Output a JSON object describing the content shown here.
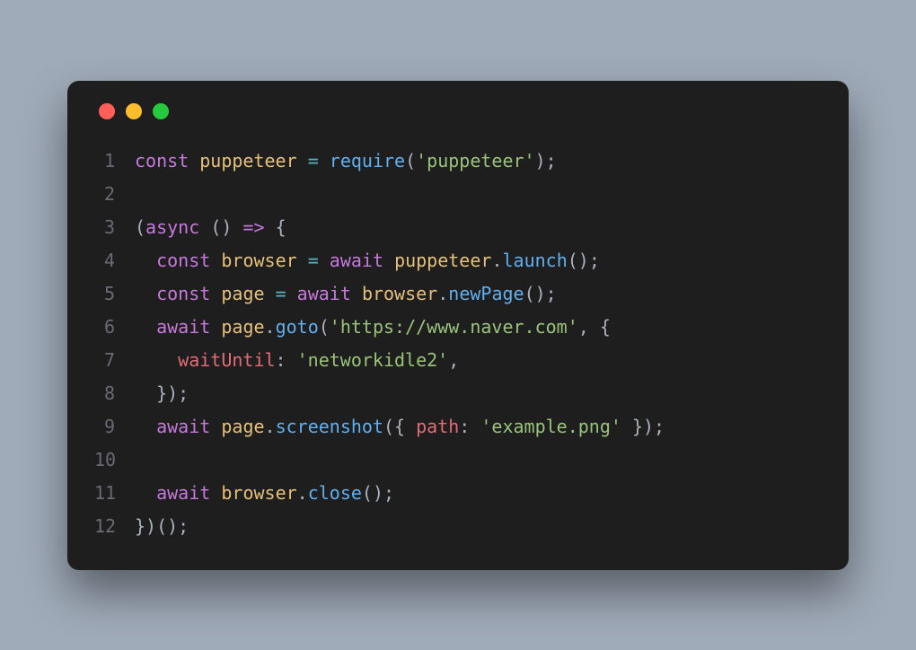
{
  "colors": {
    "red": "#ff5f56",
    "yellow": "#ffbd2e",
    "green": "#27c93f",
    "background": "#1e1e1e"
  },
  "code": {
    "lines": [
      {
        "n": "1",
        "tokens": [
          {
            "c": "kw",
            "t": "const"
          },
          {
            "c": "plain",
            "t": " "
          },
          {
            "c": "var",
            "t": "puppeteer"
          },
          {
            "c": "plain",
            "t": " "
          },
          {
            "c": "op",
            "t": "="
          },
          {
            "c": "plain",
            "t": " "
          },
          {
            "c": "fn",
            "t": "require"
          },
          {
            "c": "punc",
            "t": "("
          },
          {
            "c": "str",
            "t": "'puppeteer'"
          },
          {
            "c": "punc",
            "t": ");"
          }
        ]
      },
      {
        "n": "2",
        "tokens": []
      },
      {
        "n": "3",
        "tokens": [
          {
            "c": "punc",
            "t": "("
          },
          {
            "c": "kw",
            "t": "async"
          },
          {
            "c": "plain",
            "t": " "
          },
          {
            "c": "punc",
            "t": "()"
          },
          {
            "c": "plain",
            "t": " "
          },
          {
            "c": "kw",
            "t": "=>"
          },
          {
            "c": "plain",
            "t": " "
          },
          {
            "c": "punc",
            "t": "{"
          }
        ]
      },
      {
        "n": "4",
        "tokens": [
          {
            "c": "plain",
            "t": "  "
          },
          {
            "c": "kw",
            "t": "const"
          },
          {
            "c": "plain",
            "t": " "
          },
          {
            "c": "var",
            "t": "browser"
          },
          {
            "c": "plain",
            "t": " "
          },
          {
            "c": "op",
            "t": "="
          },
          {
            "c": "plain",
            "t": " "
          },
          {
            "c": "kw",
            "t": "await"
          },
          {
            "c": "plain",
            "t": " "
          },
          {
            "c": "var",
            "t": "puppeteer"
          },
          {
            "c": "punc",
            "t": "."
          },
          {
            "c": "fn",
            "t": "launch"
          },
          {
            "c": "punc",
            "t": "();"
          }
        ]
      },
      {
        "n": "5",
        "tokens": [
          {
            "c": "plain",
            "t": "  "
          },
          {
            "c": "kw",
            "t": "const"
          },
          {
            "c": "plain",
            "t": " "
          },
          {
            "c": "var",
            "t": "page"
          },
          {
            "c": "plain",
            "t": " "
          },
          {
            "c": "op",
            "t": "="
          },
          {
            "c": "plain",
            "t": " "
          },
          {
            "c": "kw",
            "t": "await"
          },
          {
            "c": "plain",
            "t": " "
          },
          {
            "c": "var",
            "t": "browser"
          },
          {
            "c": "punc",
            "t": "."
          },
          {
            "c": "fn",
            "t": "newPage"
          },
          {
            "c": "punc",
            "t": "();"
          }
        ]
      },
      {
        "n": "6",
        "tokens": [
          {
            "c": "plain",
            "t": "  "
          },
          {
            "c": "kw",
            "t": "await"
          },
          {
            "c": "plain",
            "t": " "
          },
          {
            "c": "var",
            "t": "page"
          },
          {
            "c": "punc",
            "t": "."
          },
          {
            "c": "fn",
            "t": "goto"
          },
          {
            "c": "punc",
            "t": "("
          },
          {
            "c": "str",
            "t": "'https://www.naver.com'"
          },
          {
            "c": "punc",
            "t": ", {"
          }
        ]
      },
      {
        "n": "7",
        "tokens": [
          {
            "c": "plain",
            "t": "    "
          },
          {
            "c": "prop",
            "t": "waitUntil"
          },
          {
            "c": "punc",
            "t": ": "
          },
          {
            "c": "str",
            "t": "'networkidle2'"
          },
          {
            "c": "punc",
            "t": ","
          }
        ]
      },
      {
        "n": "8",
        "tokens": [
          {
            "c": "plain",
            "t": "  "
          },
          {
            "c": "punc",
            "t": "});"
          }
        ]
      },
      {
        "n": "9",
        "tokens": [
          {
            "c": "plain",
            "t": "  "
          },
          {
            "c": "kw",
            "t": "await"
          },
          {
            "c": "plain",
            "t": " "
          },
          {
            "c": "var",
            "t": "page"
          },
          {
            "c": "punc",
            "t": "."
          },
          {
            "c": "fn",
            "t": "screenshot"
          },
          {
            "c": "punc",
            "t": "({ "
          },
          {
            "c": "prop",
            "t": "path"
          },
          {
            "c": "punc",
            "t": ": "
          },
          {
            "c": "str",
            "t": "'example.png'"
          },
          {
            "c": "punc",
            "t": " });"
          }
        ]
      },
      {
        "n": "10",
        "tokens": []
      },
      {
        "n": "11",
        "tokens": [
          {
            "c": "plain",
            "t": "  "
          },
          {
            "c": "kw",
            "t": "await"
          },
          {
            "c": "plain",
            "t": " "
          },
          {
            "c": "var",
            "t": "browser"
          },
          {
            "c": "punc",
            "t": "."
          },
          {
            "c": "fn",
            "t": "close"
          },
          {
            "c": "punc",
            "t": "();"
          }
        ]
      },
      {
        "n": "12",
        "tokens": [
          {
            "c": "punc",
            "t": "})();"
          }
        ]
      }
    ]
  }
}
